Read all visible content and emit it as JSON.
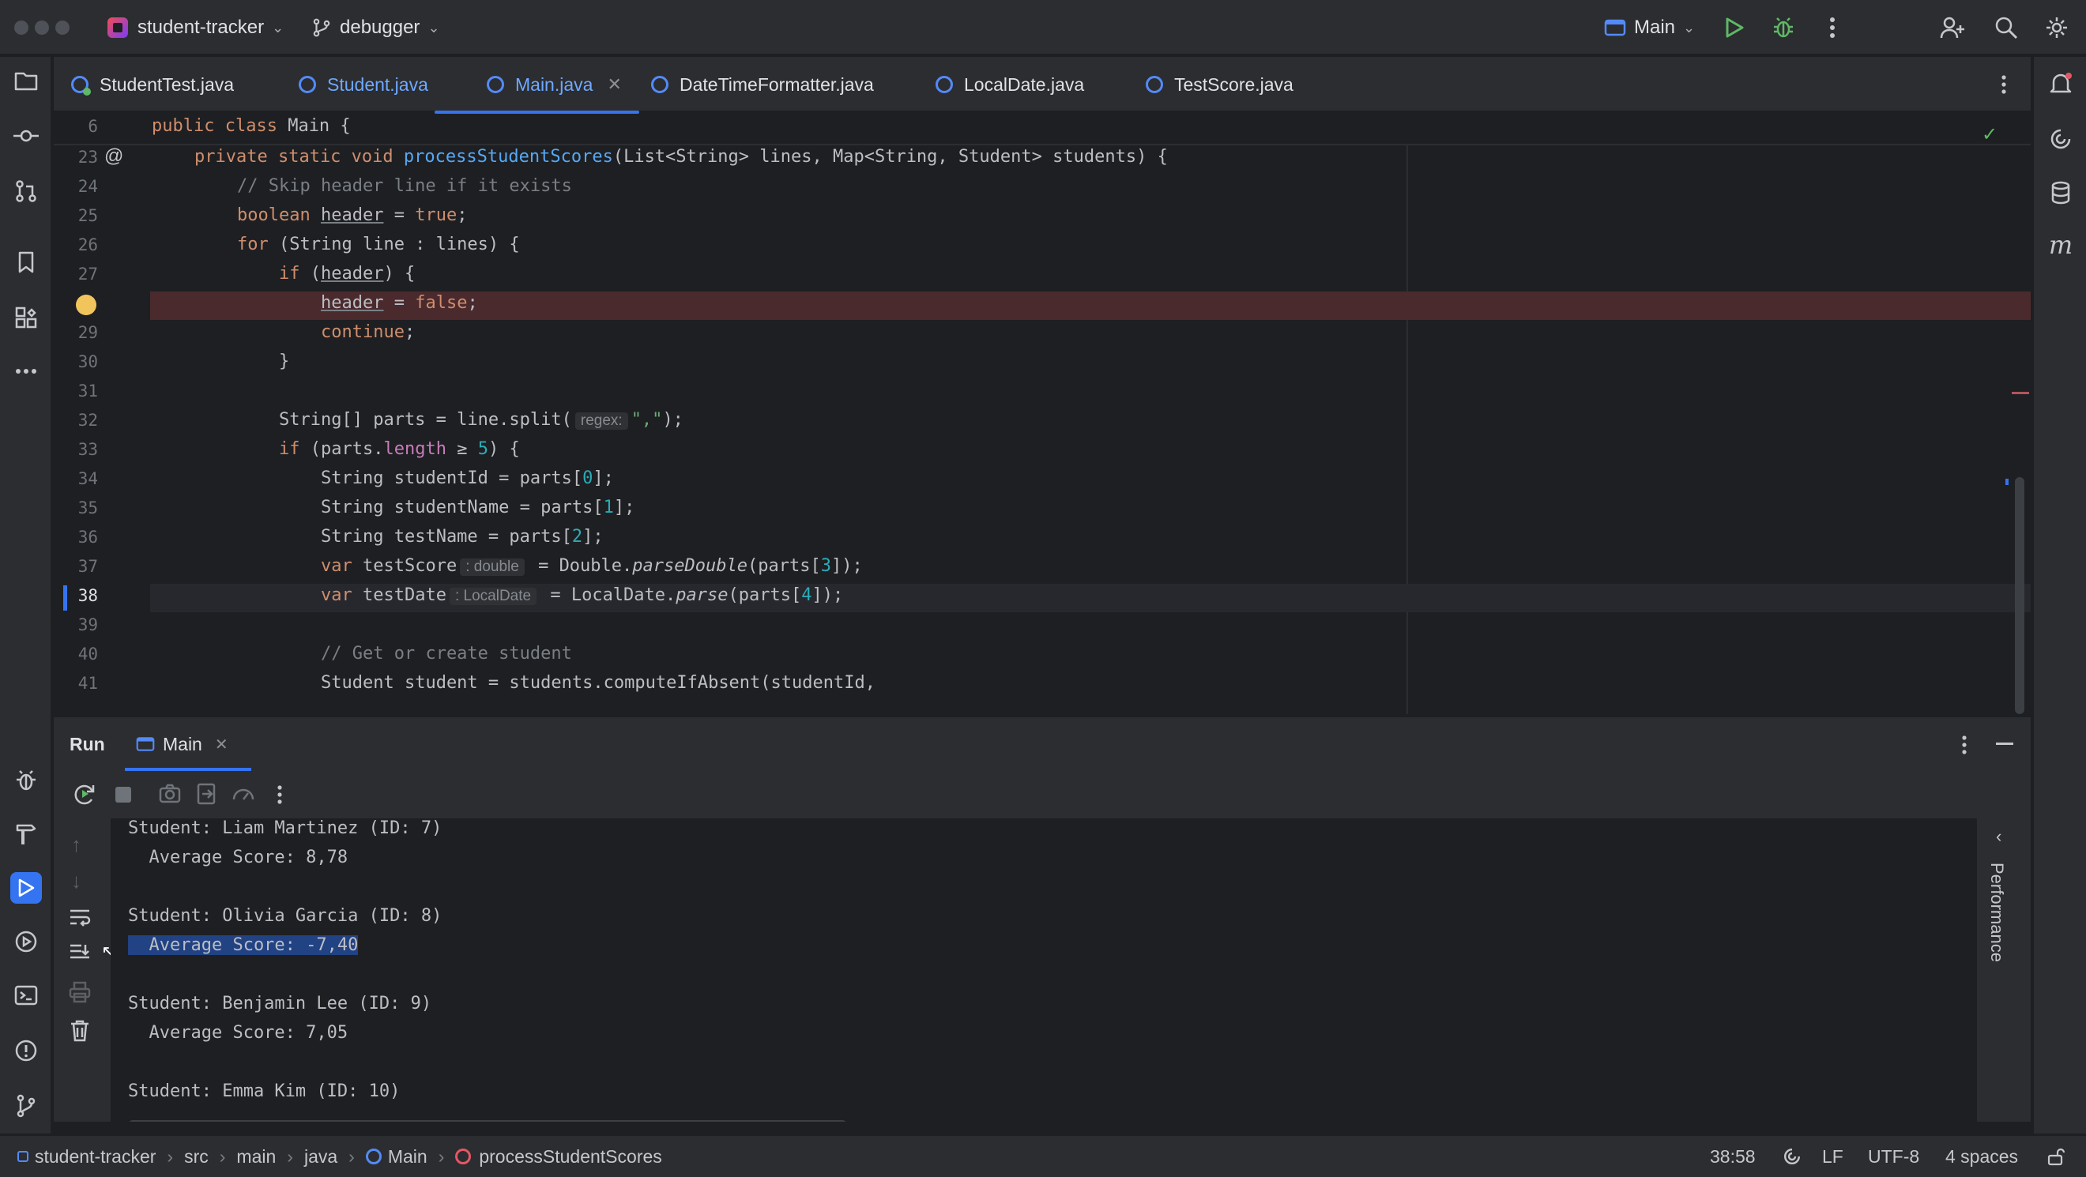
{
  "titlebar": {
    "project": "student-tracker",
    "branch": "debugger",
    "run_config": "Main"
  },
  "tabs": [
    {
      "label": "StudentTest.java"
    },
    {
      "label": "Student.java"
    },
    {
      "label": "Main.java"
    },
    {
      "label": "DateTimeFormatter.java"
    },
    {
      "label": "LocalDate.java"
    },
    {
      "label": "TestScore.java"
    }
  ],
  "editor": {
    "lines": [
      {
        "num": "6"
      },
      {
        "num": "23"
      },
      {
        "num": "24"
      },
      {
        "num": "25"
      },
      {
        "num": "26"
      },
      {
        "num": "27"
      },
      {
        "num": "28"
      },
      {
        "num": "29"
      },
      {
        "num": "30"
      },
      {
        "num": "31"
      },
      {
        "num": "32"
      },
      {
        "num": "33"
      },
      {
        "num": "34"
      },
      {
        "num": "35"
      },
      {
        "num": "36"
      },
      {
        "num": "37"
      },
      {
        "num": "38"
      },
      {
        "num": "39"
      },
      {
        "num": "40"
      },
      {
        "num": "41"
      }
    ],
    "hints": {
      "regex": "regex:",
      "double": ": double",
      "localdate": ": LocalDate"
    }
  },
  "run": {
    "title": "Run",
    "tab": "Main",
    "performance": "Performance",
    "output": [
      "Student: Liam Martinez (ID: 7)",
      "  Average Score: 8,78",
      "",
      "Student: Olivia Garcia (ID: 8)",
      "  Average Score: -7,40",
      "",
      "Student: Benjamin Lee (ID: 9)",
      "  Average Score: 7,05",
      "",
      "Student: Emma Kim (ID: 10)"
    ]
  },
  "statusbar": {
    "breadcrumbs": [
      "student-tracker",
      "src",
      "main",
      "java",
      "Main",
      "processStudentScores"
    ],
    "position": "38:58",
    "line_sep": "LF",
    "encoding": "UTF-8",
    "indent": "4 spaces"
  }
}
